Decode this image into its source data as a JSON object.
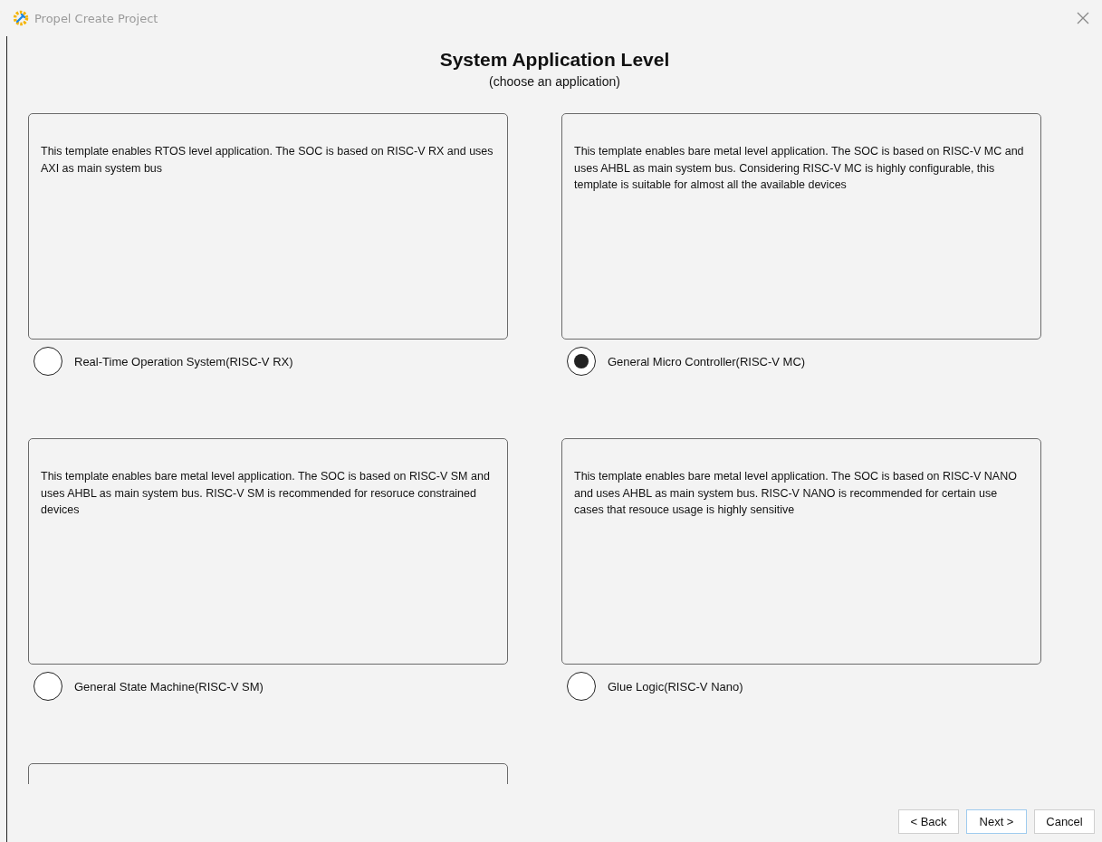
{
  "window": {
    "title": "Propel Create Project"
  },
  "heading": {
    "title": "System Application Level",
    "subtitle": "(choose an application)"
  },
  "applications": [
    {
      "description": "This template enables RTOS level application. The SOC is based on RISC-V RX and uses AXI as main system bus",
      "label": "Real-Time Operation System(RISC-V RX)",
      "selected": false
    },
    {
      "description": "This template enables bare metal level application. The SOC is based on RISC-V MC and uses AHBL as main system bus. Considering RISC-V MC is highly configurable, this template is suitable for almost all the available devices",
      "label": "General Micro Controller(RISC-V MC)",
      "selected": true
    },
    {
      "description": "This template enables bare metal level application. The SOC is based on RISC-V SM and uses AHBL as main system bus. RISC-V SM is recommended for resoruce constrained devices",
      "label": "General State Machine(RISC-V SM)",
      "selected": false
    },
    {
      "description": "This template enables bare metal level application. The SOC is based on RISC-V NANO and uses AHBL as main system bus. RISC-V NANO is recommended for certain use cases that resouce usage is highly sensitive",
      "label": "Glue Logic(RISC-V Nano)",
      "selected": false
    }
  ],
  "more_cards_below": true,
  "buttons": [
    {
      "label": "< Back",
      "focused": false
    },
    {
      "label": "Next >",
      "focused": true
    },
    {
      "label": "Cancel",
      "focused": false
    }
  ]
}
